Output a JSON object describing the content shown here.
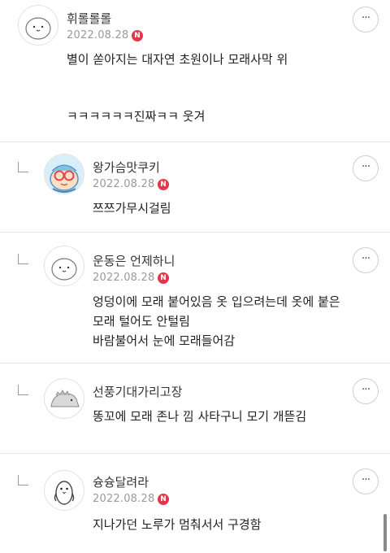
{
  "comments": [
    {
      "nickname": "휘롤롤롤",
      "date": "2022.08.28",
      "badge": "N",
      "more": "···",
      "lines": [
        "별이 쏟아지는 대자연 초원이나 모래사막 위",
        "ㅋㅋㅋㅋㅋㅋ진짜ㅋㅋ 웃겨"
      ]
    },
    {
      "nickname": "왕가슴맛쿠키",
      "date": "2022.08.28",
      "badge": "N",
      "more": "···",
      "lines": [
        "쯔쯔가무시걸림"
      ]
    },
    {
      "nickname": "운동은 언제하니",
      "date": "2022.08.28",
      "badge": "N",
      "more": "···",
      "lines": [
        "엉덩이에 모래 붙어있음 옷 입으려는데 옷에 붙은",
        "모래 털어도 안털림",
        "바람불어서 눈에 모래들어감"
      ]
    },
    {
      "nickname": "선풍기대가리고장",
      "date": "",
      "badge": "",
      "more": "···",
      "lines": [
        "똥꼬에 모래 존나 낌 사타구니 모기 개뜯김"
      ]
    },
    {
      "nickname": "슝슝달려라",
      "date": "2022.08.28",
      "badge": "N",
      "more": "···",
      "lines": [
        "지나가던 노루가 멈춰서서 구경함"
      ]
    }
  ]
}
